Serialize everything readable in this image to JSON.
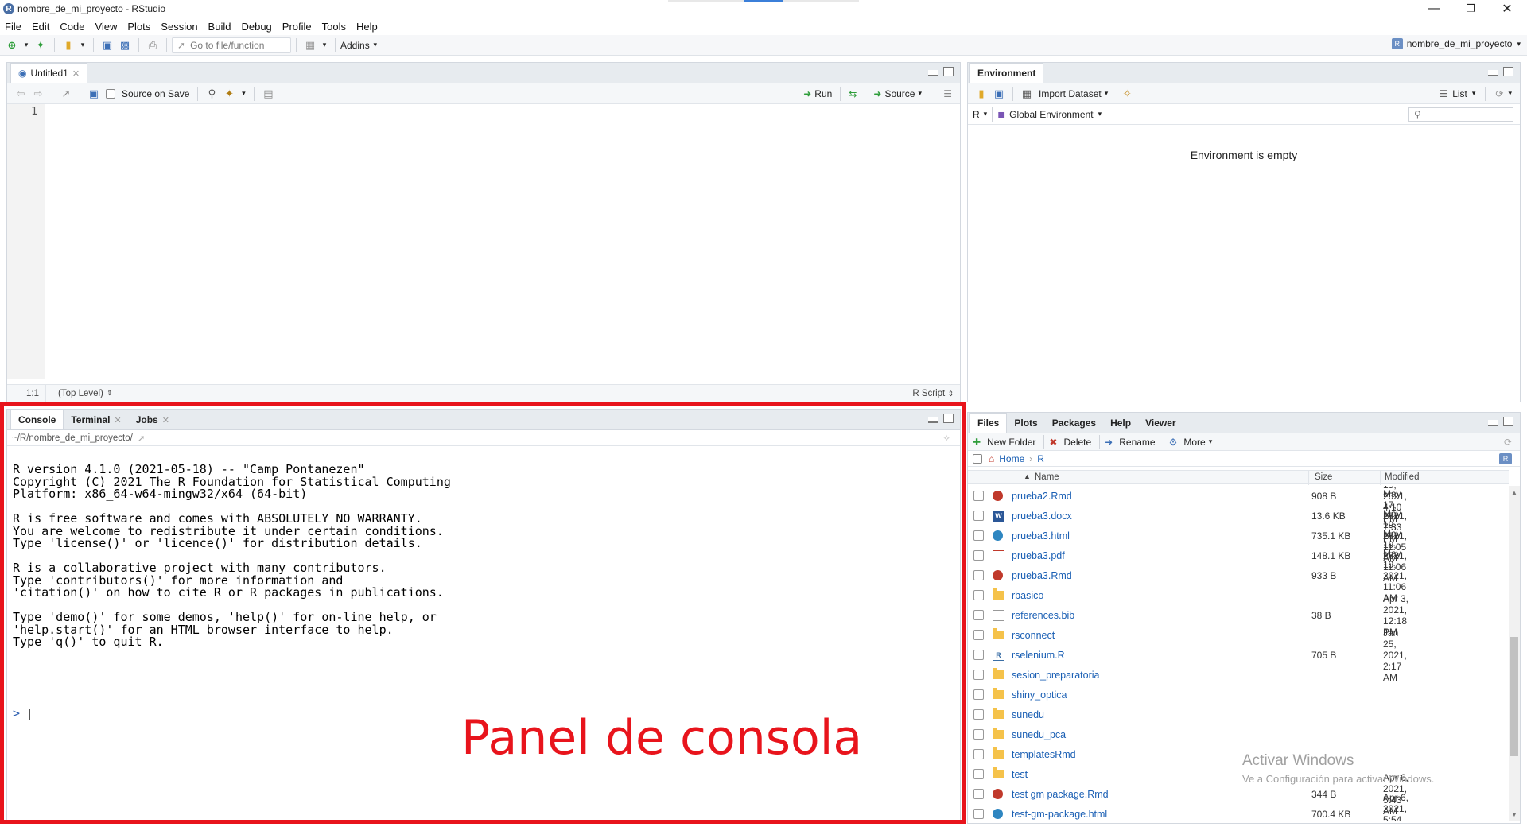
{
  "window": {
    "title": "nombre_de_mi_proyecto - RStudio",
    "app_icon": "R"
  },
  "menu": [
    "File",
    "Edit",
    "Code",
    "View",
    "Plots",
    "Session",
    "Build",
    "Debug",
    "Profile",
    "Tools",
    "Help"
  ],
  "toolbar": {
    "goto_placeholder": "Go to file/function",
    "addins_label": "Addins",
    "project_label": "nombre_de_mi_proyecto"
  },
  "editor": {
    "tab_label": "Untitled1",
    "source_on_save": "Source on Save",
    "run_label": "Run",
    "source_label": "Source",
    "line_number": "1",
    "cursor_pos": "1:1",
    "scope": "(Top Level)",
    "file_type": "R Script"
  },
  "environment": {
    "tabs": [
      "Environment"
    ],
    "import_dataset": "Import Dataset",
    "list_label": "List",
    "lang": "R",
    "scope": "Global Environment",
    "empty_message": "Environment is empty"
  },
  "console": {
    "tabs": [
      "Console",
      "Terminal",
      "Jobs"
    ],
    "path": "~/R/nombre_de_mi_proyecto/",
    "lines": [
      "R version 4.1.0 (2021-05-18) -- \"Camp Pontanezen\"",
      "Copyright (C) 2021 The R Foundation for Statistical Computing",
      "Platform: x86_64-w64-mingw32/x64 (64-bit)",
      "",
      "R is free software and comes with ABSOLUTELY NO WARRANTY.",
      "You are welcome to redistribute it under certain conditions.",
      "Type 'license()' or 'licence()' for distribution details.",
      "",
      "R is a collaborative project with many contributors.",
      "Type 'contributors()' for more information and",
      "'citation()' on how to cite R or R packages in publications.",
      "",
      "Type 'demo()' for some demos, 'help()' for on-line help, or",
      "'help.start()' for an HTML browser interface to help.",
      "Type 'q()' to quit R."
    ],
    "prompt": ">",
    "annotation": "Panel de consola",
    "annotation_color": "#e8141c"
  },
  "files": {
    "tabs": [
      "Files",
      "Plots",
      "Packages",
      "Help",
      "Viewer"
    ],
    "new_folder": "New Folder",
    "delete": "Delete",
    "rename": "Rename",
    "more": "More",
    "breadcrumb_home": "Home",
    "breadcrumb_dir": "R",
    "col_name": "Name",
    "col_size": "Size",
    "col_modified": "Modified",
    "rows": [
      {
        "name": "prueba2.Rmd",
        "size": "908 B",
        "modified": "May 15, 2021, 4:10 PM",
        "icon": "rmd"
      },
      {
        "name": "prueba3.docx",
        "size": "13.6 KB",
        "modified": "May 17, 2021, 7:33 PM",
        "icon": "word"
      },
      {
        "name": "prueba3.html",
        "size": "735.1 KB",
        "modified": "May 19, 2021, 11:05 AM",
        "icon": "html"
      },
      {
        "name": "prueba3.pdf",
        "size": "148.1 KB",
        "modified": "May 19, 2021, 11:06 AM",
        "icon": "pdf"
      },
      {
        "name": "prueba3.Rmd",
        "size": "933 B",
        "modified": "May 19, 2021, 11:06 AM",
        "icon": "rmd"
      },
      {
        "name": "rbasico",
        "size": "",
        "modified": "",
        "icon": "folder"
      },
      {
        "name": "references.bib",
        "size": "38 B",
        "modified": "Apr 3, 2021, 12:18 PM",
        "icon": "doc"
      },
      {
        "name": "rsconnect",
        "size": "",
        "modified": "",
        "icon": "folder"
      },
      {
        "name": "rselenium.R",
        "size": "705 B",
        "modified": "Jan 25, 2021, 2:17 AM",
        "icon": "r"
      },
      {
        "name": "sesion_preparatoria",
        "size": "",
        "modified": "",
        "icon": "folder"
      },
      {
        "name": "shiny_optica",
        "size": "",
        "modified": "",
        "icon": "folder"
      },
      {
        "name": "sunedu",
        "size": "",
        "modified": "",
        "icon": "folder"
      },
      {
        "name": "sunedu_pca",
        "size": "",
        "modified": "",
        "icon": "folder"
      },
      {
        "name": "templatesRmd",
        "size": "",
        "modified": "",
        "icon": "folder"
      },
      {
        "name": "test",
        "size": "",
        "modified": "",
        "icon": "folder"
      },
      {
        "name": "test gm package.Rmd",
        "size": "344 B",
        "modified": "Apr 6, 2021, 5:43 AM",
        "icon": "rmd"
      },
      {
        "name": "test-gm-package.html",
        "size": "700.4 KB",
        "modified": "Apr 6, 2021, 5:54 AM",
        "icon": "html"
      }
    ]
  },
  "watermark": {
    "line1": "Activar Windows",
    "line2": "Ve a Configuración para activar Windows."
  }
}
